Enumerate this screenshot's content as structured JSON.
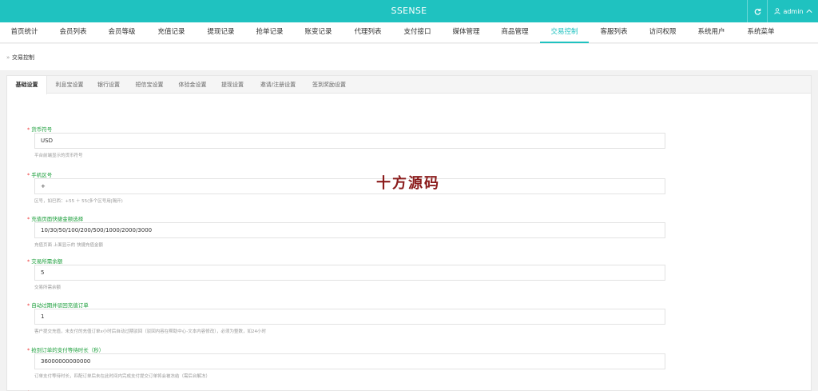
{
  "app": {
    "title": "SSENSE",
    "user_name": "admin",
    "accent_color": "#1fc2c0",
    "icons": [
      "refresh-icon",
      "user-icon",
      "chevron-up-icon",
      "breadcrumb-arrow-icon"
    ]
  },
  "nav": {
    "items": [
      {
        "label": "首页统计"
      },
      {
        "label": "会员列表"
      },
      {
        "label": "会员等级"
      },
      {
        "label": "充值记录"
      },
      {
        "label": "提现记录"
      },
      {
        "label": "抢单记录"
      },
      {
        "label": "账变记录"
      },
      {
        "label": "代理列表"
      },
      {
        "label": "支付接口"
      },
      {
        "label": "媒体管理"
      },
      {
        "label": "商品管理"
      },
      {
        "label": "交易控制"
      },
      {
        "label": "客服列表"
      },
      {
        "label": "访问权限"
      },
      {
        "label": "系统用户"
      },
      {
        "label": "系统菜单"
      }
    ],
    "active": "交易控制"
  },
  "breadcrumb": {
    "icon": "»",
    "text": "交易控制"
  },
  "tabs": {
    "items": [
      {
        "label": "基础设置"
      },
      {
        "label": "利息宝设置"
      },
      {
        "label": "银行设置"
      },
      {
        "label": "短信宝设置"
      },
      {
        "label": "体验金设置"
      },
      {
        "label": "提现设置"
      },
      {
        "label": "邀请/注册设置"
      },
      {
        "label": "签到奖励设置"
      }
    ],
    "active": "基础设置"
  },
  "form": {
    "fields": [
      {
        "label": "货币符号",
        "value": "USD",
        "help": "平台前端显示的货币符号"
      },
      {
        "label": "手机区号",
        "value": "+",
        "help": "区号，如巴西：+55 ＋ 55(多个区号用|隔开)"
      },
      {
        "label": "充值页面快捷金额选择",
        "value": "10/30/50/100/200/500/1000/2000/3000",
        "help": "充值页面 上面显示的 快捷充值金额"
      },
      {
        "label": "交易所需余额",
        "value": "5",
        "help": "交易所需余额"
      },
      {
        "label": "自动过期并驳回充值订单",
        "value": "1",
        "help": "客户提交充值，未支付的充值订单x小时后自动过期驳回（驳回内容在帮助中心-文本内容修改），必须为整数，如24小时"
      },
      {
        "label": "抢到订单的支付等待时长（秒）",
        "value": "36000000000000",
        "help": "订单支付等待时长，匹配订单后未在此时间内完成支付提交订单将会被冻结（需后台解冻）"
      }
    ]
  },
  "watermark": "十方源码"
}
